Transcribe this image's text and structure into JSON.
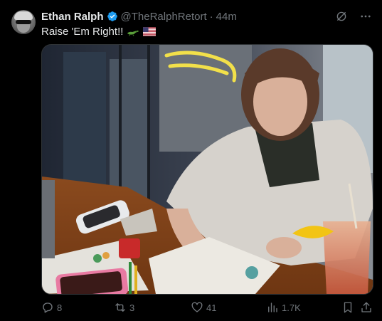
{
  "author": {
    "name": "Ethan Ralph",
    "handle": "@TheRalphRetort",
    "separator": "·",
    "time": "44m",
    "avatar_icon": "avatar-photo",
    "verified_icon": "verified-badge-icon"
  },
  "tweet": {
    "text": "Raise 'Em Right!!",
    "emojis": [
      "alligator-emoji",
      "us-flag-emoji"
    ]
  },
  "media": {
    "type": "photo"
  },
  "actions": {
    "replies": "8",
    "reposts": "3",
    "likes": "41",
    "views": "1.7K"
  },
  "colors": {
    "background": "#000000",
    "text": "#e7e9ea",
    "muted": "#71767b",
    "verified": "#1d9bf0"
  }
}
